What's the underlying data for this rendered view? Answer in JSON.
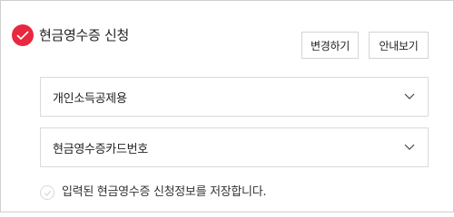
{
  "header": {
    "title": "현금영수증 신청",
    "checked": true,
    "accent_color": "#e8283f",
    "check_icon": "check-icon"
  },
  "buttons": {
    "change_label": "변경하기",
    "guide_label": "안내보기"
  },
  "selects": [
    {
      "value": "개인소득공제용",
      "icon": "chevron-down-icon"
    },
    {
      "value": "현금영수증카드번호",
      "icon": "chevron-down-icon"
    }
  ],
  "save_option": {
    "label": "입력된 현금영수증 신청정보를 저장합니다.",
    "checked": false
  }
}
